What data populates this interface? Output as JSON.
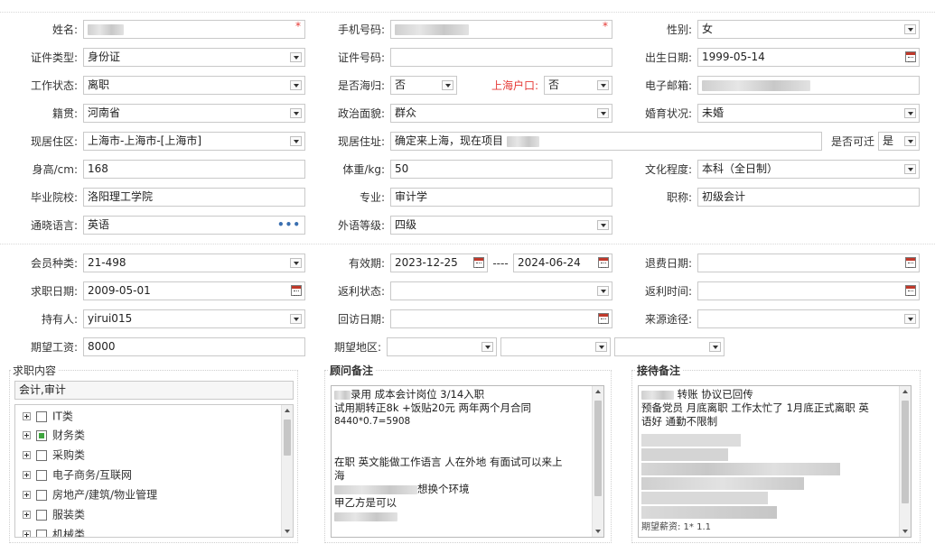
{
  "personal": {
    "name": {
      "label": "姓名:",
      "value": "",
      "required": "*"
    },
    "phone": {
      "label": "手机号码:",
      "value": "",
      "required": "*"
    },
    "gender": {
      "label": "性别:",
      "value": "女"
    },
    "id_type": {
      "label": "证件类型:",
      "value": "身份证"
    },
    "id_no": {
      "label": "证件号码:",
      "value": ""
    },
    "birth": {
      "label": "出生日期:",
      "value": "1999-05-14"
    },
    "work_status": {
      "label": "工作状态:",
      "value": "离职"
    },
    "returnee": {
      "label": "是否海归:",
      "value": "否"
    },
    "shanghai_hukou": {
      "label": "上海户口:",
      "value": "否"
    },
    "email": {
      "label": "电子邮箱:",
      "value": ""
    },
    "native": {
      "label": "籍贯:",
      "value": "河南省"
    },
    "political": {
      "label": "政治面貌:",
      "value": "群众"
    },
    "marital": {
      "label": "婚育状况:",
      "value": "未婚"
    },
    "region": {
      "label": "现居住区:",
      "value": "上海市-上海市-[上海市]"
    },
    "address": {
      "label": "现居住址:",
      "value": "确定来上海，现在项目"
    },
    "relocate": {
      "label": "是否可迁",
      "value": "是"
    },
    "height": {
      "label": "身高/cm:",
      "value": "168"
    },
    "weight": {
      "label": "体重/kg:",
      "value": "50"
    },
    "education": {
      "label": "文化程度:",
      "value": "本科（全日制）"
    },
    "school": {
      "label": "毕业院校:",
      "value": "洛阳理工学院"
    },
    "major": {
      "label": "专业:",
      "value": "审计学"
    },
    "title": {
      "label": "职称:",
      "value": "初级会计"
    },
    "language": {
      "label": "通晓语言:",
      "value": "英语"
    },
    "lang_level": {
      "label": "外语等级:",
      "value": "四级"
    }
  },
  "membership": {
    "type": {
      "label": "会员种类:",
      "value": "21-498"
    },
    "validity": {
      "label": "有效期:",
      "from": "2023-12-25",
      "sep": "----",
      "to": "2024-06-24"
    },
    "refund_date": {
      "label": "退费日期:",
      "value": ""
    },
    "apply_date": {
      "label": "求职日期:",
      "value": "2009-05-01"
    },
    "rebate_status": {
      "label": "返利状态:",
      "value": ""
    },
    "rebate_time": {
      "label": "返利时间:",
      "value": ""
    },
    "holder": {
      "label": "持有人:",
      "value": "yirui015"
    },
    "visit_date": {
      "label": "回访日期:",
      "value": ""
    },
    "source": {
      "label": "来源途径:",
      "value": ""
    },
    "salary": {
      "label": "期望工资:",
      "value": "8000"
    },
    "area": {
      "label": "期望地区:",
      "values": [
        "",
        "",
        ""
      ]
    }
  },
  "job_content": {
    "title": "求职内容",
    "summary": "会计,审计",
    "categories": [
      {
        "label": "IT类",
        "checked": false
      },
      {
        "label": "财务类",
        "checked": true
      },
      {
        "label": "采购类",
        "checked": false
      },
      {
        "label": "电子商务/互联网",
        "checked": false
      },
      {
        "label": "房地产/建筑/物业管理",
        "checked": false
      },
      {
        "label": "服装类",
        "checked": false
      },
      {
        "label": "机械类",
        "checked": false
      }
    ]
  },
  "consultant_note": {
    "title": "顾问备注",
    "lines": [
      "录用 成本会计岗位 3/14入职",
      "试用期转正8k +饭贴20元 两年两个月合同",
      "8440*0.7=5908",
      "",
      "",
      "在职 英文能做工作语言  人在外地 有面试可以来上",
      "海",
      "想换个环境",
      "甲乙方是可以"
    ]
  },
  "reception_note": {
    "title": "接待备注",
    "lines": [
      "转账 协议已回传",
      "预备党员 月底离职 工作太忙了 1月底正式离职 英",
      "语好  通勤不限制"
    ],
    "footer": "期望薪资: 1* 1.1"
  },
  "colors": {
    "required": "#e53935",
    "hukou_label": "#e53935",
    "checked": "#3ea53e"
  }
}
